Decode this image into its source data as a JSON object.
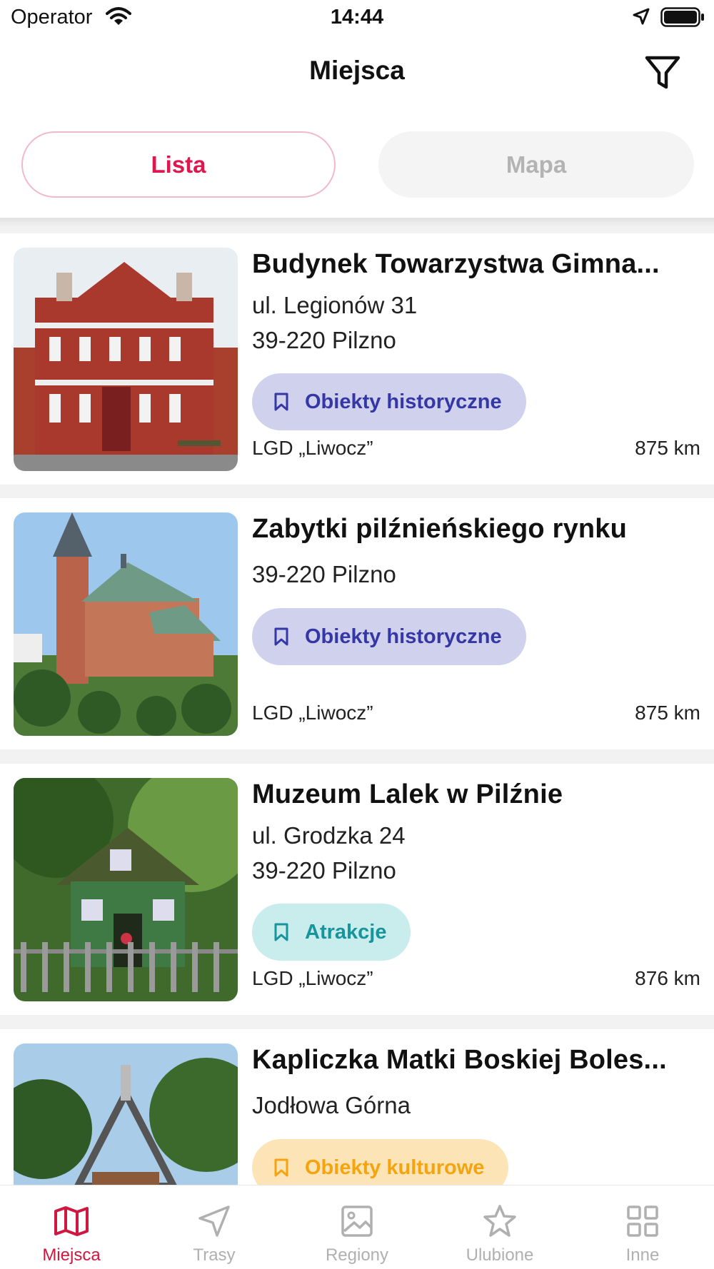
{
  "status_bar": {
    "carrier": "Operator",
    "time": "14:44"
  },
  "header": {
    "title": "Miejsca",
    "filter_icon": "filter-icon"
  },
  "segmented": {
    "list_label": "Lista",
    "map_label": "Mapa",
    "selected": "Lista"
  },
  "colors": {
    "accent": "#e0174f",
    "historic_bg": "#cfd1ed",
    "historic_fg": "#3437a4",
    "attraction_bg": "#c9ecec",
    "attraction_fg": "#17949c",
    "culture_bg": "#fde4b6",
    "culture_fg": "#f5a40f"
  },
  "places": [
    {
      "title": "Budynek Towarzystwa Gimna...",
      "street": "ul. Legionów 31",
      "city": "39-220 Pilzno",
      "category": "Obiekty historyczne",
      "organization": "LGD „Liwocz”",
      "distance": "875 km"
    },
    {
      "title": "Zabytki pilźnieńskiego rynku",
      "city": "39-220 Pilzno",
      "category": "Obiekty historyczne",
      "organization": "LGD „Liwocz”",
      "distance": "875 km"
    },
    {
      "title": "Muzeum Lalek w Pilźnie",
      "street": "ul. Grodzka 24",
      "city": "39-220 Pilzno",
      "category": "Atrakcje",
      "organization": "LGD „Liwocz”",
      "distance": "876 km"
    },
    {
      "title": "Kapliczka Matki Boskiej Boles...",
      "city": "Jodłowa Górna",
      "category": "Obiekty kulturowe"
    }
  ],
  "tabs": [
    {
      "label": "Miejsca",
      "icon": "map-icon",
      "active": true
    },
    {
      "label": "Trasy",
      "icon": "navigation-icon",
      "active": false
    },
    {
      "label": "Regiony",
      "icon": "image-icon",
      "active": false
    },
    {
      "label": "Ulubione",
      "icon": "star-icon",
      "active": false
    },
    {
      "label": "Inne",
      "icon": "grid-icon",
      "active": false
    }
  ]
}
